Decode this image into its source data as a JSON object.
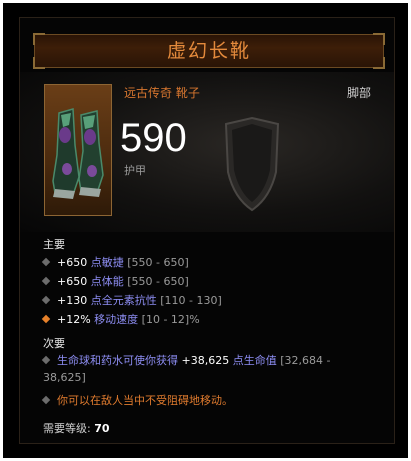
{
  "item": {
    "name": "虚幻长靴",
    "type": "远古传奇 靴子",
    "slot": "脚部",
    "armor_value": "590",
    "armor_label": "护甲"
  },
  "primary": {
    "heading": "主要",
    "stats": [
      {
        "value": "+650",
        "name": "点敏捷",
        "range": "[550 - 650]"
      },
      {
        "value": "+650",
        "name": "点体能",
        "range": "[550 - 650]"
      },
      {
        "value": "+130",
        "name": "点全元素抗性",
        "range": "[110 - 130]"
      },
      {
        "value": "+12%",
        "name": "移动速度",
        "range": "[10 - 12]%"
      }
    ]
  },
  "secondary": {
    "heading": "次要",
    "stat1_prefix": "生命球和药水可使你获得",
    "stat1_value": "+38,625",
    "stat1_suffix": "点生命值",
    "stat1_range_a": "[32,684 -",
    "stat1_range_b": "38,625]",
    "stat2": "你可以在敌人当中不受阻碍地移动。"
  },
  "requirement": {
    "label": "需要等级:",
    "level": "70"
  },
  "colors": {
    "title": "#e48a3c",
    "type": "#d7762f",
    "stat_name_blue": "#8d8df2",
    "legendary_orange": "#e07b2e"
  }
}
